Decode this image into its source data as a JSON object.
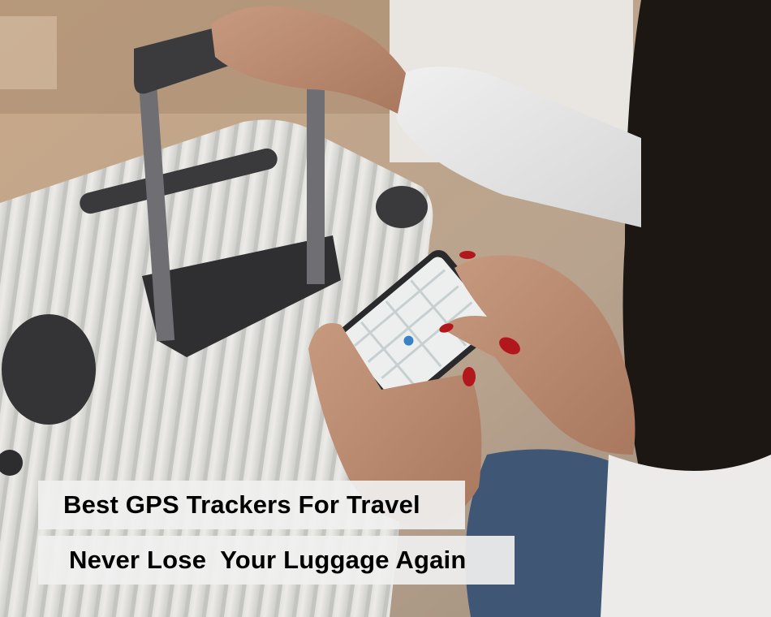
{
  "captions": {
    "title": "Best GPS Trackers For Travel",
    "subtitle": "Never Lose  Your Luggage Again"
  }
}
